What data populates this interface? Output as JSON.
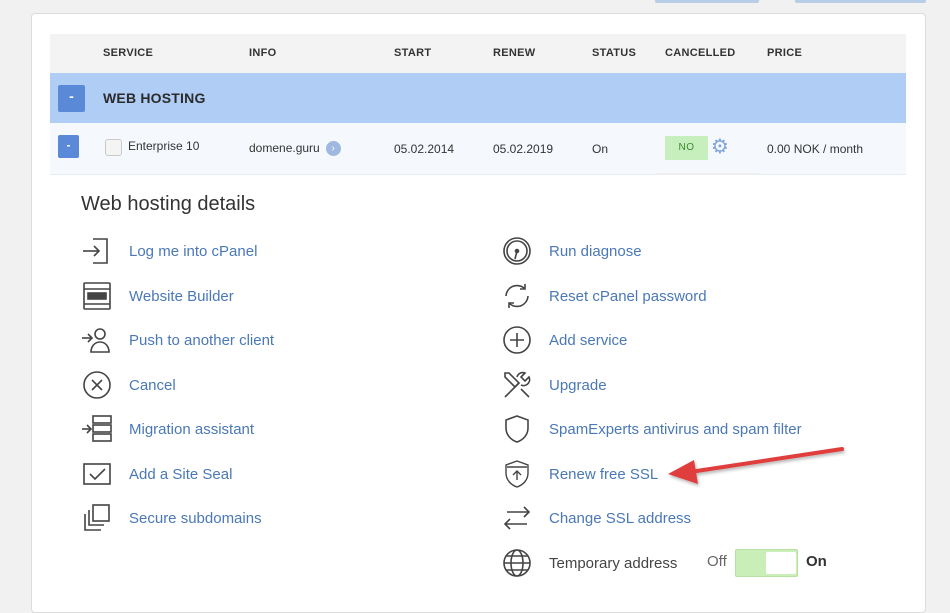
{
  "table": {
    "headers": [
      "SERVICE",
      "INFO",
      "START",
      "RENEW",
      "STATUS",
      "CANCELLED",
      "PRICE"
    ],
    "group": {
      "collapse_label": "-",
      "title": "WEB HOSTING"
    },
    "row": {
      "collapse_label": "-",
      "service": "Enterprise 10",
      "info": "domene.guru",
      "start": "05.02.2014",
      "renew": "05.02.2019",
      "status": "On",
      "cancelled": "NO",
      "price": "0.00 NOK / month"
    }
  },
  "details": {
    "title": "Web hosting details",
    "left_actions": [
      {
        "label": "Log me into cPanel",
        "icon": "login-icon"
      },
      {
        "label": "Website Builder",
        "icon": "website-builder-icon"
      },
      {
        "label": "Push to another client",
        "icon": "push-client-icon"
      },
      {
        "label": "Cancel",
        "icon": "cancel-icon"
      },
      {
        "label": "Migration assistant",
        "icon": "migration-icon"
      },
      {
        "label": "Add a Site Seal",
        "icon": "site-seal-icon"
      },
      {
        "label": "Secure subdomains",
        "icon": "subdomains-icon"
      }
    ],
    "right_actions": [
      {
        "label": "Run diagnose",
        "icon": "gauge-icon"
      },
      {
        "label": "Reset cPanel password",
        "icon": "refresh-icon"
      },
      {
        "label": "Add service",
        "icon": "plus-circle-icon"
      },
      {
        "label": "Upgrade",
        "icon": "tools-icon"
      },
      {
        "label": "SpamExperts antivirus and spam filter",
        "icon": "shield-icon"
      },
      {
        "label": "Renew free SSL",
        "icon": "ssl-shield-icon"
      },
      {
        "label": "Change SSL address",
        "icon": "swap-arrows-icon"
      },
      {
        "label": "Temporary address",
        "icon": "globe-icon"
      }
    ],
    "toggle": {
      "off_label": "Off",
      "on_label": "On",
      "state": "on"
    }
  },
  "colors": {
    "group_bg": "#b0cdf5",
    "button_blue": "#5a89d8",
    "link_blue": "#4a78b8",
    "badge_green": "#c7efbd",
    "arrow_red": "#e03c3c"
  }
}
